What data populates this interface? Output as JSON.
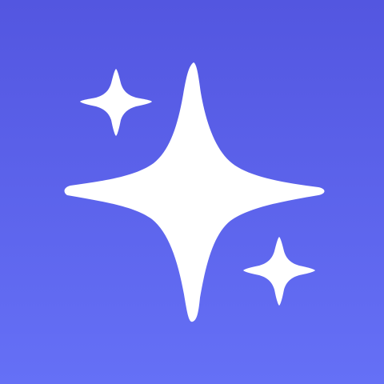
{
  "app_icon": {
    "name": "sparkles-icon",
    "colors": {
      "background_top": "#5356e0",
      "background_bottom": "#6570f6",
      "star": "#ffffff"
    },
    "stars": [
      {
        "name": "large-sparkle-icon"
      },
      {
        "name": "small-sparkle-top-left-icon"
      },
      {
        "name": "small-sparkle-bottom-right-icon"
      }
    ]
  }
}
